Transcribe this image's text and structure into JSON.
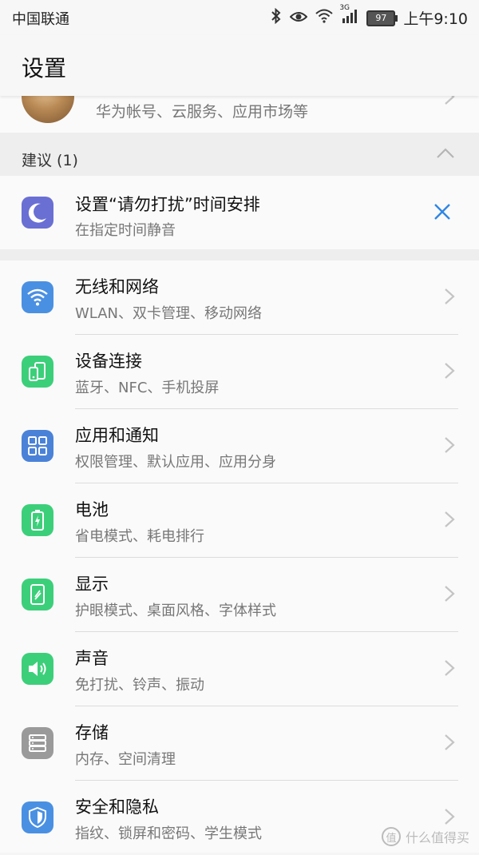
{
  "status_bar": {
    "carrier": "中国联通",
    "network": "3G",
    "battery": "97",
    "time": "上午9:10"
  },
  "app_bar": {
    "title": "设置"
  },
  "account": {
    "subtitle": "华为帐号、云服务、应用市场等"
  },
  "suggestions": {
    "header": "建议 (1)",
    "item": {
      "title": "设置“请勿打扰”时间安排",
      "subtitle": "在指定时间静音",
      "icon": "moon-icon",
      "color": "#6a6fd3"
    }
  },
  "settings": [
    {
      "title": "无线和网络",
      "subtitle": "WLAN、双卡管理、移动网络",
      "icon": "wifi-icon",
      "color": "#4a90e2"
    },
    {
      "title": "设备连接",
      "subtitle": "蓝牙、NFC、手机投屏",
      "icon": "device-connect-icon",
      "color": "#3ccf7a"
    },
    {
      "title": "应用和通知",
      "subtitle": "权限管理、默认应用、应用分身",
      "icon": "apps-grid-icon",
      "color": "#4a82d8"
    },
    {
      "title": "电池",
      "subtitle": "省电模式、耗电排行",
      "icon": "battery-icon",
      "color": "#3ccf7a"
    },
    {
      "title": "显示",
      "subtitle": "护眼模式、桌面风格、字体样式",
      "icon": "display-icon",
      "color": "#3ccf7a"
    },
    {
      "title": "声音",
      "subtitle": "免打扰、铃声、振动",
      "icon": "speaker-icon",
      "color": "#3ccf7a"
    },
    {
      "title": "存储",
      "subtitle": "内存、空间清理",
      "icon": "storage-icon",
      "color": "#9a9a9a"
    },
    {
      "title": "安全和隐私",
      "subtitle": "指纹、锁屏和密码、学生模式",
      "icon": "shield-icon",
      "color": "#4a90e2"
    }
  ],
  "watermark": {
    "text": "什么值得买",
    "badge": "值"
  }
}
